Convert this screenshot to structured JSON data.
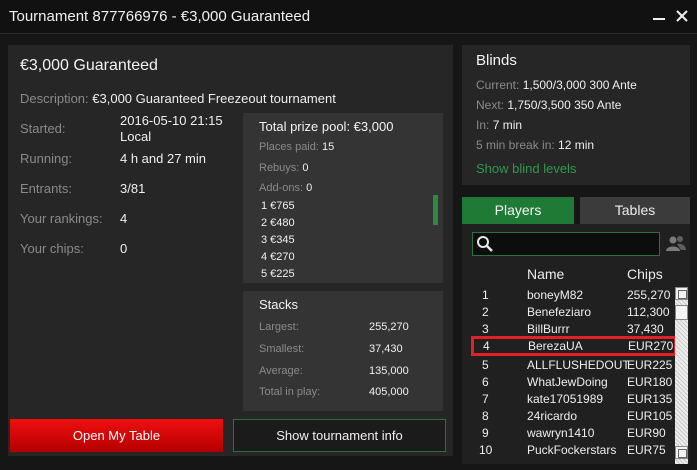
{
  "window": {
    "title": "Tournament 877766976 - €3,000 Guaranteed"
  },
  "tournament": {
    "heading": "€3,000 Guaranteed",
    "description_label": "Description:",
    "description": "€3,000 Guaranteed Freezeout tournament",
    "started_label": "Started:",
    "started_date": "2016-05-10 21:15",
    "started_tz": "Local",
    "running_label": "Running:",
    "running": "4 h and 27 min",
    "entrants_label": "Entrants:",
    "entrants": "3/81",
    "rankings_label": "Your rankings:",
    "rankings": "4",
    "chips_label": "Your chips:",
    "chips": "0"
  },
  "prize": {
    "total": "Total prize pool: €3,000",
    "places_paid_label": "Places paid:",
    "places_paid": "15",
    "rebuys_label": "Rebuys:",
    "rebuys": "0",
    "addons_label": "Add-ons:",
    "addons": "0",
    "places": [
      "1 €765",
      "2 €480",
      "3 €345",
      "4 €270",
      "5 €225"
    ]
  },
  "stacks": {
    "heading": "Stacks",
    "largest_label": "Largest:",
    "largest": "255,270",
    "smallest_label": "Smallest:",
    "smallest": "37,430",
    "average_label": "Average:",
    "average": "135,000",
    "total_label": "Total in play:",
    "total": "405,000"
  },
  "buttons": {
    "open_table": "Open My Table",
    "show_info": "Show tournament info"
  },
  "blinds": {
    "heading": "Blinds",
    "current_label": "Current:",
    "current": "1,500/3,000 300 Ante",
    "next_label": "Next:",
    "next": "1,750/3,500 350 Ante",
    "in_label": "In:",
    "in": "7 min",
    "break_label": "5 min break in:",
    "break": "12 min",
    "link": "Show blind levels"
  },
  "tabs": {
    "players": "Players",
    "tables": "Tables"
  },
  "players": {
    "col_name": "Name",
    "col_chips": "Chips",
    "rows": [
      {
        "rank": "1",
        "name": "boneyM82",
        "chips": "255,270"
      },
      {
        "rank": "2",
        "name": "Benefeziaro",
        "chips": "112,300"
      },
      {
        "rank": "3",
        "name": "BillBurrr",
        "chips": "37,430"
      },
      {
        "rank": "4",
        "name": "BerezaUA",
        "chips": "EUR270"
      },
      {
        "rank": "5",
        "name": "ALLFLUSHEDOUT",
        "chips": "EUR225"
      },
      {
        "rank": "6",
        "name": "WhatJewDoing",
        "chips": "EUR180"
      },
      {
        "rank": "7",
        "name": "kate17051989",
        "chips": "EUR135"
      },
      {
        "rank": "8",
        "name": "24ricardo",
        "chips": "EUR105"
      },
      {
        "rank": "9",
        "name": "wawryn1410",
        "chips": "EUR90"
      },
      {
        "rank": "10",
        "name": "PuckFockerstars",
        "chips": "EUR75"
      }
    ]
  },
  "colors": {
    "accent_green": "#1f7a35",
    "highlight_red": "#e2202a",
    "button_red": "#f00f0f"
  }
}
